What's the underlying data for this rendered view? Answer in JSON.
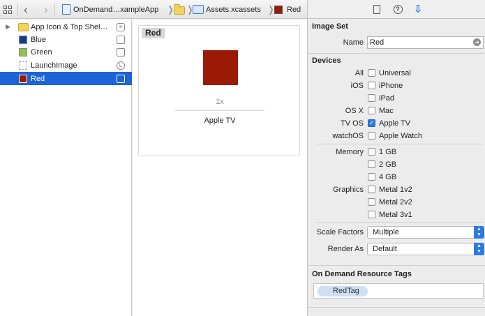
{
  "jumpbar": {
    "crumbs": [
      "OnDemand…xampleApp",
      "Assets.xcassets",
      "Red"
    ]
  },
  "asset_list": [
    {
      "label": "App Icon & Top Shel…",
      "icon": "folder-icon",
      "disclosure": true,
      "badge": "stack-badge-icon"
    },
    {
      "label": "Blue",
      "color": "#0f3f8a",
      "badge": "square-badge-icon"
    },
    {
      "label": "Green",
      "color": "#8ac64b",
      "badge": "square-badge-icon"
    },
    {
      "label": "LaunchImage",
      "color": "#ffffff",
      "badge": "L"
    },
    {
      "label": "Red",
      "color": "#9b1a05",
      "badge": "square-badge-icon",
      "selected": true
    }
  ],
  "editor": {
    "card_title": "Red",
    "swatch_color": "#9b1a05",
    "scale": "1x",
    "idiom": "Apple TV"
  },
  "inspector": {
    "tabs": [
      "file-icon",
      "help-icon",
      "attributes-icon"
    ],
    "image_set": {
      "title": "Image Set",
      "name_label": "Name",
      "name_value": "Red"
    },
    "devices": {
      "title": "Devices",
      "rows": [
        {
          "label": "All",
          "option": "Universal",
          "checked": false
        },
        {
          "label": "iOS",
          "option": "iPhone",
          "checked": false
        },
        {
          "label": "",
          "option": "iPad",
          "checked": false
        },
        {
          "label": "OS X",
          "option": "Mac",
          "checked": false
        },
        {
          "label": "TV OS",
          "option": "Apple TV",
          "checked": true
        },
        {
          "label": "watchOS",
          "option": "Apple Watch",
          "checked": false
        }
      ]
    },
    "memory": {
      "label": "Memory",
      "options": [
        {
          "option": "1 GB",
          "checked": false
        },
        {
          "option": "2 GB",
          "checked": false
        },
        {
          "option": "4 GB",
          "checked": false
        }
      ]
    },
    "graphics": {
      "label": "Graphics",
      "options": [
        {
          "option": "Metal 1v2",
          "checked": false
        },
        {
          "option": "Metal 2v2",
          "checked": false
        },
        {
          "option": "Metal 3v1",
          "checked": false
        }
      ]
    },
    "scale_factors": {
      "label": "Scale Factors",
      "value": "Multiple"
    },
    "render_as": {
      "label": "Render As",
      "value": "Default"
    },
    "odr": {
      "title": "On Demand Resource Tags",
      "tags": [
        "RedTag"
      ]
    }
  }
}
